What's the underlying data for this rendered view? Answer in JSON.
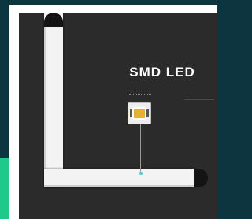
{
  "title": "SMD LED",
  "colors": {
    "background": "#0d3540",
    "frame": "#ffffff",
    "panel": "#2b2b2b",
    "accent": "#1fc98a",
    "led": "#e4b51e",
    "indicator": "#3ad1e6"
  }
}
